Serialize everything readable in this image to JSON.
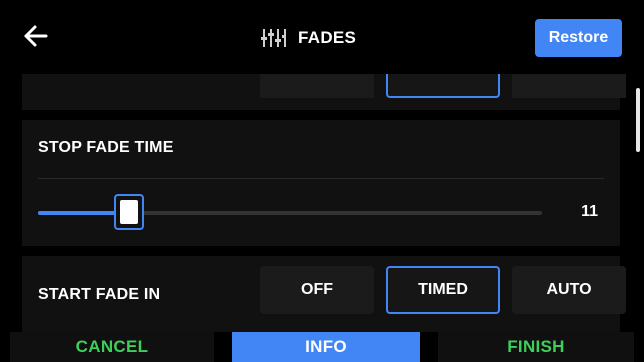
{
  "header": {
    "title": "FADES",
    "title_icon": "mixer-faders-icon",
    "back_icon": "back-arrow-icon",
    "restore_label": "Restore"
  },
  "stop_fade_time": {
    "label": "STOP FADE TIME",
    "value": "11",
    "slider_fraction": 0.18
  },
  "start_fade_in": {
    "label": "START FADE IN",
    "options": [
      "OFF",
      "TIMED",
      "AUTO"
    ],
    "selected": "TIMED"
  },
  "footer": {
    "cancel_label": "CANCEL",
    "info_label": "INFO",
    "finish_label": "FINISH"
  },
  "colors": {
    "accent": "#4285f4",
    "confirm": "#3ecf5a",
    "background": "#000000",
    "panel": "#111111"
  }
}
